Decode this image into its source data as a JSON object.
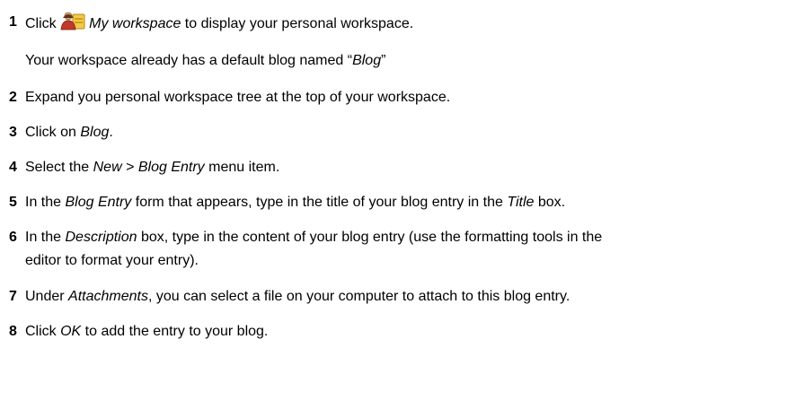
{
  "steps": [
    {
      "num": "1",
      "parts": [
        "Click ",
        "",
        "My workspace",
        " to display your personal workspace."
      ],
      "note": [
        "Your workspace already has a default blog named “",
        "Blog",
        "”"
      ]
    },
    {
      "num": "2",
      "text": "Expand you personal workspace tree at the top of your workspace."
    },
    {
      "num": "3",
      "parts": [
        "Click on ",
        "Blog",
        "."
      ]
    },
    {
      "num": "4",
      "parts": [
        "Select the ",
        "New",
        " > ",
        "Blog Entry",
        " menu item."
      ]
    },
    {
      "num": "5",
      "parts": [
        "In the ",
        "Blog Entry",
        " form that appears, type in the title of your blog entry in the ",
        "Title",
        " box."
      ]
    },
    {
      "num": "6",
      "parts": [
        "In the ",
        "Description",
        " box, type in the content of your blog entry (use the formatting tools in the",
        "editor to format your entry)."
      ]
    },
    {
      "num": "7",
      "parts": [
        "Under ",
        "Attachments",
        ", you can select a file on your computer to attach to this blog entry."
      ]
    },
    {
      "num": "8",
      "parts": [
        "Click ",
        "OK",
        " to add the entry to your blog."
      ]
    }
  ],
  "icons": {
    "workspace": "my-workspace-icon"
  }
}
